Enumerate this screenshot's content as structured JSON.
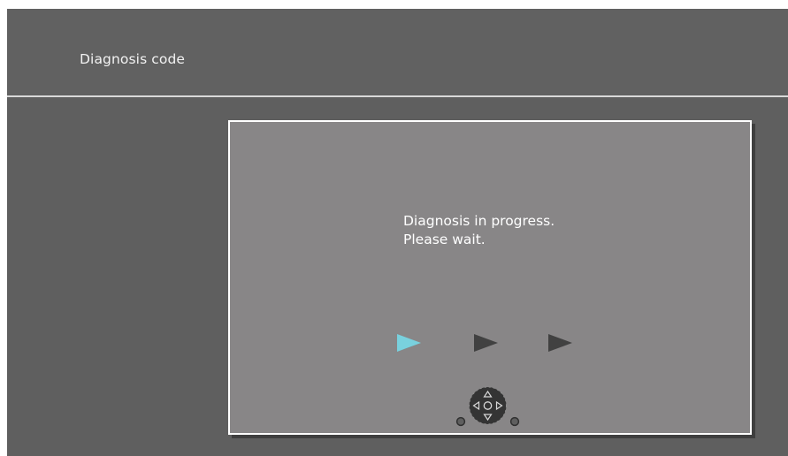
{
  "header": {
    "title": "Diagnosis code"
  },
  "dialog": {
    "message_line1": "Diagnosis in progress.",
    "message_line2": "Please wait."
  },
  "progress": {
    "steps": 3,
    "active_step": 1,
    "active_color": "#79d1de",
    "inactive_color": "#414141"
  },
  "controls": {
    "icon": "dpad-navigation-icon"
  },
  "colors": {
    "screen_bg": "#5f5f5f",
    "dialog_bg": "#888687",
    "divider": "#d9d9d9"
  }
}
